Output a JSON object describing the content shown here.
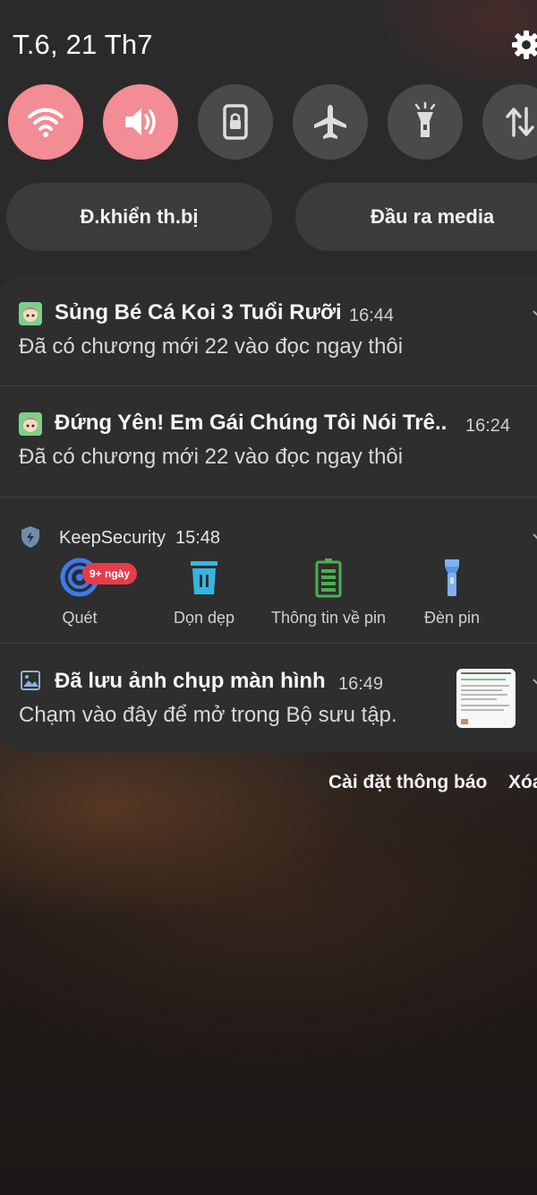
{
  "status_bar": {
    "date": "T.6, 21 Th7",
    "settings_icon": "gear-icon"
  },
  "quick_settings": {
    "tiles": [
      {
        "icon": "wifi-icon",
        "state": "on"
      },
      {
        "icon": "volume-icon",
        "state": "on"
      },
      {
        "icon": "rotation-lock-icon",
        "state": "off"
      },
      {
        "icon": "airplane-icon",
        "state": "off"
      },
      {
        "icon": "flashlight-icon",
        "state": "off"
      },
      {
        "icon": "mobile-data-icon",
        "state": "off"
      }
    ],
    "device_control_label": "Đ.khiển th.bị",
    "media_output_label": "Đầu ra media"
  },
  "notifications": [
    {
      "app_icon": "comic-app-icon",
      "title": "Sủng Bé Cá Koi 3 Tuổi Rưỡi",
      "time": "16:44",
      "body": "Đã có chương mới 22 vào đọc ngay thôi"
    },
    {
      "app_icon": "comic-app-icon",
      "title": "Đứng Yên! Em Gái Chúng Tôi Nói Trê..",
      "time": "16:24",
      "body": "Đã có chương mới 22 vào đọc ngay thôi"
    },
    {
      "app_icon": "shield-icon",
      "app": "KeepSecurity",
      "time": "15:48",
      "actions": [
        {
          "label": "Quét",
          "icon": "scan-icon",
          "badge": "9+ ngày"
        },
        {
          "label": "Dọn dẹp",
          "icon": "trash-icon"
        },
        {
          "label": "Thông tin về pin",
          "icon": "battery-icon"
        },
        {
          "label": "Đèn pin",
          "icon": "flashlight-icon"
        }
      ]
    },
    {
      "app_icon": "image-icon",
      "title": "Đã lưu ảnh chụp màn hình",
      "time": "16:49",
      "body": "Chạm vào đây để mở trong Bộ sưu tập."
    }
  ],
  "footer": {
    "notification_settings": "Cài đặt thông báo",
    "clear": "Xóa"
  },
  "colors": {
    "tile_on": "#f28c95",
    "tile_off": "#4a4a4a",
    "panel": "#2e2e2e",
    "badge": "#e83b4a"
  }
}
